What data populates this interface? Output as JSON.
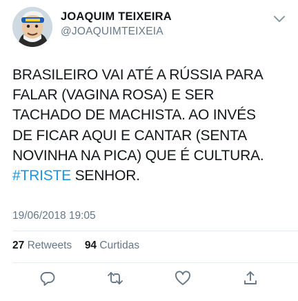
{
  "author": {
    "name": "JOAQUIM TEIXEIRA",
    "handle": "@JOAQUIMTEIXEIA",
    "avatar_icon": "caricature-avatar-icon",
    "menu_icon": "chevron-down-icon"
  },
  "tweet": {
    "lines": [
      "BRASILEIRO VAI ATÉ A RÚSSIA PARA",
      "FALAR (VAGINA ROSA) E SER",
      "TACHADO DE MACHISTA. AO INVÉS",
      "DE FICAR AQUI E CANTAR (SENTA",
      "NOVINHA NA PICA) QUE É CULTURA."
    ],
    "hashtag": "#TRISTE",
    "after_hashtag": " SENHOR.",
    "hashtag_color": "#1b95e0"
  },
  "timestamp": "19/06/2018 19:05",
  "stats": {
    "retweets_count": "27",
    "retweets_label": "Retweets",
    "likes_count": "94",
    "likes_label": "Curtidas"
  },
  "actions": {
    "reply_icon": "reply-icon",
    "retweet_icon": "retweet-icon",
    "like_icon": "heart-icon",
    "share_icon": "share-icon"
  },
  "colors": {
    "text": "#14171a",
    "secondary": "#657786",
    "accent": "#1b95e0",
    "divider": "#e6ecf0"
  }
}
